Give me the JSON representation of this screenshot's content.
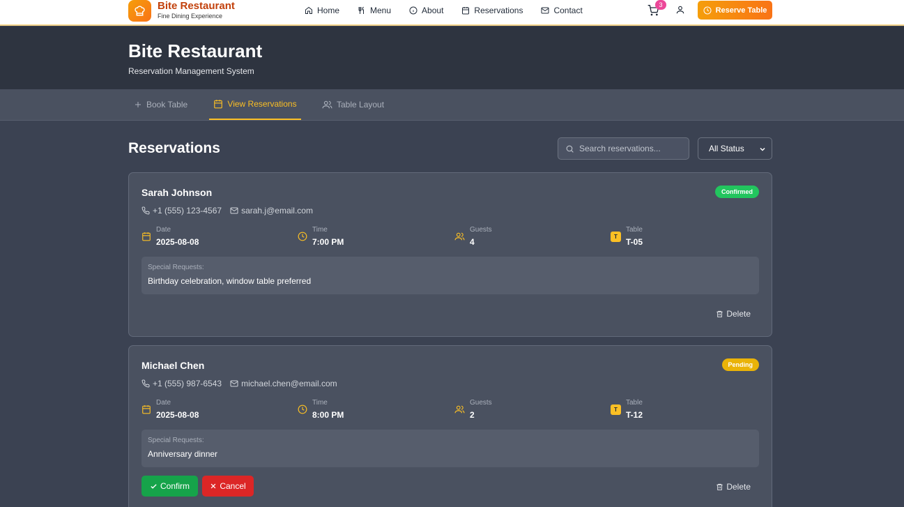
{
  "nav": {
    "brand_name": "Bite Restaurant",
    "brand_tagline": "Fine Dining Experience",
    "links": [
      {
        "label": "Home",
        "icon": "home-icon"
      },
      {
        "label": "Menu",
        "icon": "utensils-icon"
      },
      {
        "label": "About",
        "icon": "info-icon"
      },
      {
        "label": "Reservations",
        "icon": "calendar-icon"
      },
      {
        "label": "Contact",
        "icon": "mail-icon"
      }
    ],
    "cart_count": "3",
    "reserve_label": "Reserve Table"
  },
  "hero": {
    "title": "Bite Restaurant",
    "subtitle": "Reservation Management System"
  },
  "tabs": [
    {
      "label": "Book Table",
      "icon": "plus-icon",
      "active": false
    },
    {
      "label": "View Reservations",
      "icon": "calendar-icon",
      "active": true
    },
    {
      "label": "Table Layout",
      "icon": "users-icon",
      "active": false
    }
  ],
  "reservations_section": {
    "title": "Reservations",
    "search_placeholder": "Search reservations...",
    "status_filter": "All Status"
  },
  "labels": {
    "date": "Date",
    "time": "Time",
    "guests": "Guests",
    "table": "Table",
    "table_chip": "T",
    "special_requests": "Special Requests:",
    "delete": "Delete",
    "confirm": "Confirm",
    "cancel": "Cancel"
  },
  "reservations": [
    {
      "name": "Sarah Johnson",
      "status": "Confirmed",
      "status_color": "#22c55e",
      "phone": "+1 (555) 123-4567",
      "email": "sarah.j@email.com",
      "date": "2025-08-08",
      "time": "7:00 PM",
      "guests": "4",
      "table": "T-05",
      "special_requests": "Birthday celebration, window table preferred"
    },
    {
      "name": "Michael Chen",
      "status": "Pending",
      "status_color": "#eab308",
      "phone": "+1 (555) 987-6543",
      "email": "michael.chen@email.com",
      "date": "2025-08-08",
      "time": "8:00 PM",
      "guests": "2",
      "table": "T-12",
      "special_requests": "Anniversary dinner"
    }
  ],
  "colors": {
    "accent": "#fbbf24",
    "brand": "#f97316",
    "confirm": "#16a34a",
    "cancel": "#dc2626"
  }
}
